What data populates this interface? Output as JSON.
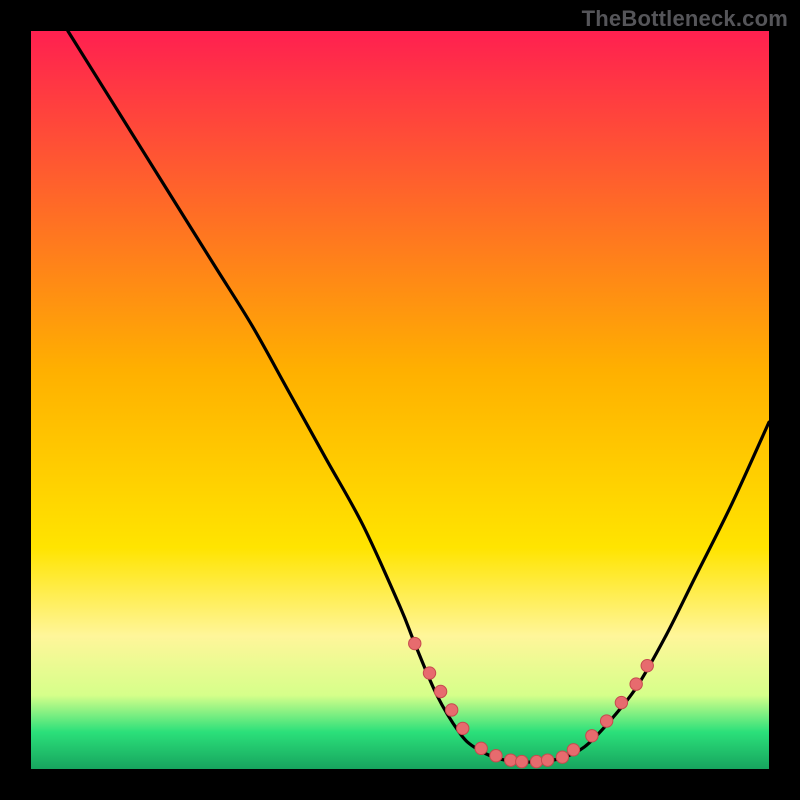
{
  "watermark": "TheBottleneck.com",
  "colors": {
    "top": "#ff2050",
    "yellow": "#ffe400",
    "paleYellow": "#fff69a",
    "green": "#2be07a",
    "darkGreen": "#17a45e",
    "curve": "#000000",
    "dotFill": "#e76b6e",
    "dotStroke": "#c64a4e",
    "frame": "#000000"
  },
  "chart_data": {
    "type": "line",
    "title": "",
    "xlabel": "",
    "ylabel": "",
    "xlim": [
      0,
      100
    ],
    "ylim": [
      0,
      100
    ],
    "series": [
      {
        "name": "bottleneck-curve",
        "x": [
          5,
          10,
          15,
          20,
          25,
          30,
          35,
          40,
          45,
          50,
          52,
          55,
          58,
          60,
          63,
          66,
          69,
          72,
          75,
          78,
          82,
          86,
          90,
          95,
          100
        ],
        "y": [
          100,
          92,
          84,
          76,
          68,
          60,
          51,
          42,
          33,
          22,
          17,
          10,
          5,
          3,
          1.5,
          1,
          1,
          1.5,
          3,
          6,
          11,
          18,
          26,
          36,
          47
        ]
      }
    ],
    "markers": {
      "name": "highlight-dots",
      "x": [
        52,
        54,
        55.5,
        57,
        58.5,
        61,
        63,
        65,
        66.5,
        68.5,
        70,
        72,
        73.5,
        76,
        78,
        80,
        82,
        83.5
      ],
      "y": [
        17,
        13,
        10.5,
        8,
        5.5,
        2.8,
        1.8,
        1.2,
        1,
        1,
        1.2,
        1.6,
        2.6,
        4.5,
        6.5,
        9,
        11.5,
        14
      ]
    }
  }
}
